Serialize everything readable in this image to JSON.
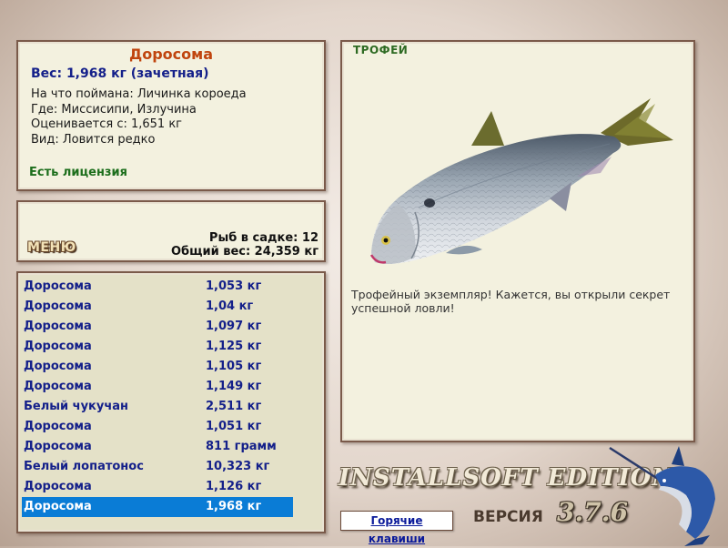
{
  "catch_info": {
    "name": "Доросома",
    "weight": "Вес: 1,968 кг (зачетная)",
    "bait": "На что поймана: Личинка короеда",
    "location": "Где: Миссисипи, Излучина",
    "value": "Оценивается с: 1,651 кг",
    "rarity": "Вид: Ловится редко",
    "license": "Есть лицензия"
  },
  "menu": {
    "label": "МЕНЮ",
    "fish_in_keepnet": "Рыб в садке: 12",
    "total_weight": "Общий вес: 24,359 кг"
  },
  "catch_list": [
    {
      "name": "Доросома",
      "weight": "1,053 кг"
    },
    {
      "name": "Доросома",
      "weight": "1,04 кг"
    },
    {
      "name": "Доросома",
      "weight": "1,097 кг"
    },
    {
      "name": "Доросома",
      "weight": "1,125 кг"
    },
    {
      "name": "Доросома",
      "weight": "1,105 кг"
    },
    {
      "name": "Доросома",
      "weight": "1,149 кг"
    },
    {
      "name": "Белый чукучан",
      "weight": "2,511 кг"
    },
    {
      "name": "Доросома",
      "weight": "1,051 кг"
    },
    {
      "name": "Доросома",
      "weight": "811 грамм"
    },
    {
      "name": "Белый лопатонос",
      "weight": "10,323 кг"
    },
    {
      "name": "Доросома",
      "weight": "1,126 кг"
    },
    {
      "name": "Доросома",
      "weight": "1,968 кг",
      "selected": true
    }
  ],
  "trophy": {
    "title": "ТРОФЕЙ",
    "text": "Трофейный экземпляр! Кажется, вы открыли секрет успешной ловли!"
  },
  "footer": {
    "edition": "INSTALLSOFT EDITION",
    "version_label": "ВЕРСИЯ",
    "version": "3.7.6",
    "hotkeys": "Горячие клавиши"
  },
  "colors": {
    "selected_row": "#0a7cd6",
    "fish_name": "#c0450e",
    "list_text": "#14208a",
    "license": "#1c6e1c",
    "trophy_title": "#2d6a22"
  },
  "icons": {
    "trophy_image": "gizzard-shad-fish-illustration",
    "logo": "blue-marlin-logo"
  }
}
